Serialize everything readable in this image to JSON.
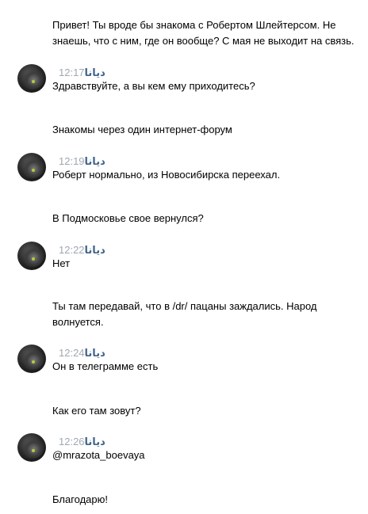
{
  "messages": [
    {
      "type": "self",
      "text": "Привет! Ты вроде бы знакома с Робертом Шлейтерсом. Не знаешь, что с ним, где он вообще? С мая не выходит на связь."
    },
    {
      "type": "other",
      "author": "دیانا",
      "time": "12:17",
      "text": "Здравствуйте, а вы кем ему приходитесь?"
    },
    {
      "type": "self",
      "text": "Знакомы через один интернет-форум"
    },
    {
      "type": "other",
      "author": "دیانا",
      "time": "12:19",
      "text": "Роберт нормально, из Новосибирска переехал."
    },
    {
      "type": "self",
      "text": "В Подмосковье свое вернулся?"
    },
    {
      "type": "other",
      "author": "دیانا",
      "time": "12:22",
      "text": "Нет"
    },
    {
      "type": "self",
      "text": "Ты там передавай, что в /dr/ пацаны заждались. Народ волнуется."
    },
    {
      "type": "other",
      "author": "دیانا",
      "time": "12:24",
      "text": "Он в телеграмме есть"
    },
    {
      "type": "self",
      "text": "Как его там зовут?"
    },
    {
      "type": "other",
      "author": "دیانا",
      "time": "12:26",
      "text": "@mrazota_boevaya"
    },
    {
      "type": "self",
      "text": "Благодарю!"
    }
  ],
  "colors": {
    "author_name": "#42648b",
    "timestamp": "#a0a8b2",
    "text": "#000000",
    "background": "#ffffff"
  }
}
